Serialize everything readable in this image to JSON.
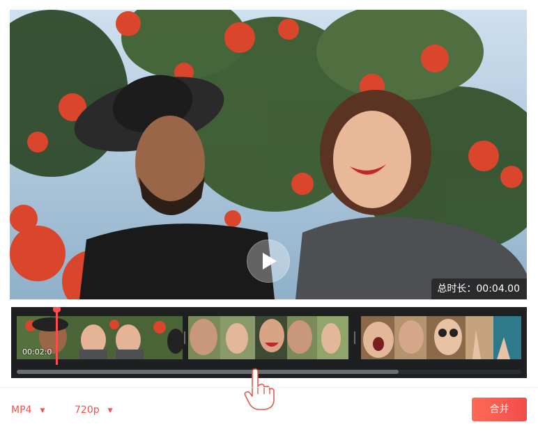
{
  "video": {
    "duration_label": "总时长：",
    "duration_value": "00:04.00",
    "play_icon": "play-icon"
  },
  "timeline": {
    "current_time": "00:02:0",
    "clip_count": 3
  },
  "export": {
    "format": "MP4",
    "resolution": "720p",
    "merge_label": "合并"
  },
  "colors": {
    "accent": "#f0524f",
    "merge_button": "#ff5a50",
    "timeline_bg": "#1e1f20",
    "playhead": "#ff4d4f"
  }
}
